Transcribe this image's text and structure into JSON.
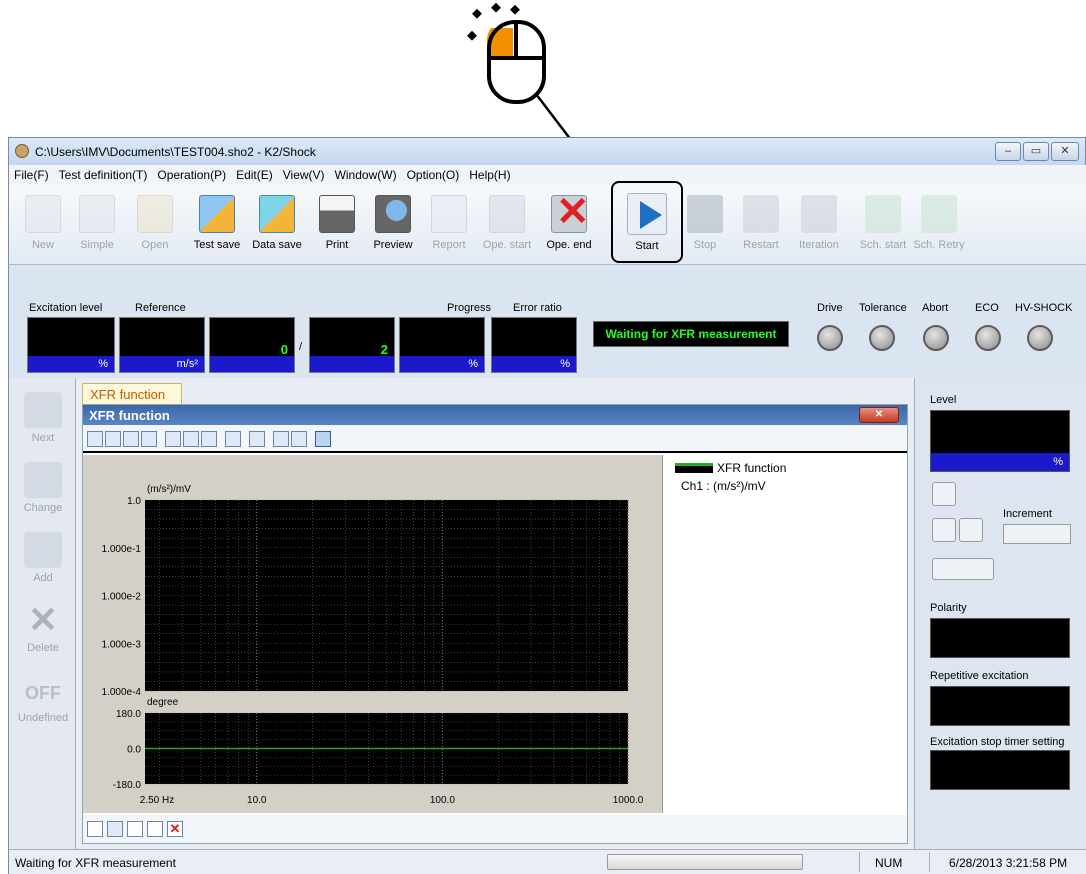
{
  "window": {
    "title": "C:\\Users\\IMV\\Documents\\TEST004.sho2 - K2/Shock",
    "controls": [
      "–",
      "▭",
      "✕"
    ]
  },
  "menu": [
    "File(F)",
    "Test definition(T)",
    "Operation(P)",
    "Edit(E)",
    "View(V)",
    "Window(W)",
    "Option(O)",
    "Help(H)"
  ],
  "toolbar": {
    "items": [
      {
        "label": "New",
        "icon": "new-document-icon",
        "enabled": false
      },
      {
        "label": "Simple",
        "icon": "simple-document-icon",
        "enabled": false
      },
      {
        "label": "Open",
        "icon": "open-folder-icon",
        "enabled": false
      },
      {
        "label": "Test save",
        "icon": "test-save-icon",
        "enabled": true
      },
      {
        "label": "Data save",
        "icon": "data-save-icon",
        "enabled": true
      },
      {
        "label": "Print",
        "icon": "printer-icon",
        "enabled": true
      },
      {
        "label": "Preview",
        "icon": "print-preview-icon",
        "enabled": true
      },
      {
        "label": "Report",
        "icon": "word-report-icon",
        "enabled": false
      },
      {
        "label": "Ope. start",
        "icon": "operation-start-icon",
        "enabled": false
      },
      {
        "label": "Ope. end",
        "icon": "operation-end-icon",
        "enabled": true
      },
      {
        "label": "Start",
        "icon": "play-icon",
        "enabled": true,
        "highlighted": true
      },
      {
        "label": "Stop",
        "icon": "stop-icon",
        "enabled": false
      },
      {
        "label": "Restart",
        "icon": "restart-icon",
        "enabled": false
      },
      {
        "label": "Iteration",
        "icon": "iteration-icon",
        "enabled": false
      },
      {
        "label": "Sch. start",
        "icon": "schedule-start-icon",
        "enabled": false
      },
      {
        "label": "Sch. Retry",
        "icon": "schedule-retry-icon",
        "enabled": false
      }
    ]
  },
  "status_panel": {
    "excitation_label": "Excitation level",
    "excitation_unit": "%",
    "reference_label": "Reference",
    "reference_unit": "m/s²",
    "count_current": "0",
    "count_sep": "/",
    "count_total": "2",
    "progress_label": "Progress",
    "progress_unit": "%",
    "error_label": "Error ratio",
    "error_unit": "%",
    "message": "Waiting for XFR measurement",
    "lamps": [
      "Drive",
      "Tolerance",
      "Abort",
      "ECO",
      "HV-SHOCK"
    ]
  },
  "left_bar": [
    {
      "label": "Next",
      "icon": "down-arrow-icon"
    },
    {
      "label": "Change",
      "icon": "pencil-icon"
    },
    {
      "label": "Add",
      "icon": "add-icon"
    },
    {
      "label": "Delete",
      "icon": "delete-icon"
    },
    {
      "label": "Undefined",
      "icon": "off-icon",
      "badge": "OFF"
    }
  ],
  "tab_label": "XFR function",
  "subwindow": {
    "title": "XFR function",
    "close": "✕"
  },
  "legend": {
    "entry": "XFR function",
    "channel": "Ch1 : (m/s²)/mV",
    "color": "#22aa22"
  },
  "right_panel": {
    "level_label": "Level",
    "level_unit": "%",
    "increment_label": "Increment",
    "polarity_label": "Polarity",
    "repetitive_label": "Repetitive excitation",
    "timer_label": "Excitation stop timer setting"
  },
  "statusbar": {
    "message": "Waiting for XFR measurement",
    "num": "NUM",
    "datetime": "6/28/2013  3:21:58 PM"
  },
  "chart_data": [
    {
      "type": "line",
      "title": "",
      "ylabel": "(m/s²)/mV",
      "yscale": "log",
      "ylim": [
        0.0001,
        1.0
      ],
      "yticks": [
        "1.0",
        "1.000e-1",
        "1.000e-2",
        "1.000e-3",
        "1.000e-4"
      ],
      "xscale": "log",
      "xlim": [
        2.5,
        1000.0
      ],
      "grid": true,
      "series": []
    },
    {
      "type": "line",
      "title": "",
      "ylabel": "degree",
      "ylim": [
        -180.0,
        180.0
      ],
      "yticks": [
        "180.0",
        "0.0",
        "-180.0"
      ],
      "xscale": "log",
      "xlim": [
        2.5,
        1000.0
      ],
      "xticks": [
        "2.50 Hz",
        "10.0",
        "100.0",
        "1000.0"
      ],
      "grid": true,
      "series": [
        {
          "name": "XFR function",
          "x": [
            2.5,
            1000.0
          ],
          "y": [
            0.0,
            0.0
          ]
        }
      ]
    }
  ]
}
